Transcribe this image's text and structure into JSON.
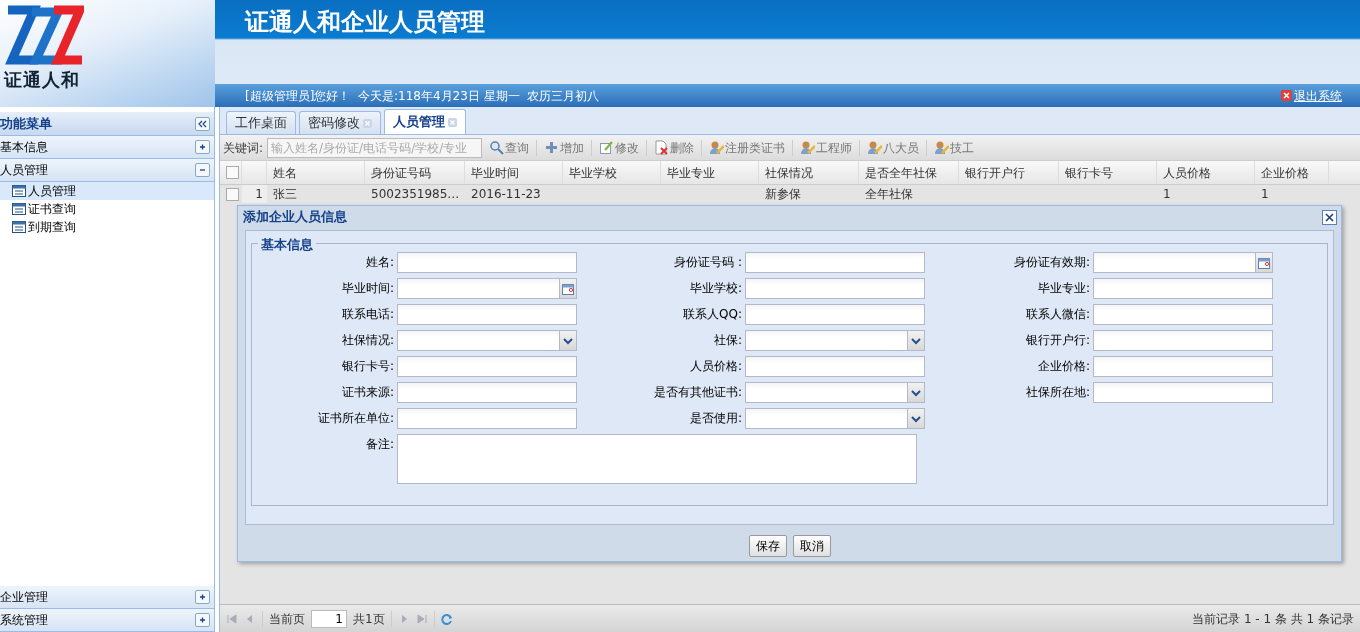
{
  "header": {
    "logo_text": "证通人和",
    "title": "证通人和企业人员管理",
    "greeting": "[超级管理员]您好！  今天是:118年4月23日 星期一  农历三月初八",
    "logout": "退出系统"
  },
  "sidebar": {
    "title": "功能菜单",
    "sections": [
      {
        "label": "基本信息",
        "expanded": false
      },
      {
        "label": "人员管理",
        "expanded": true,
        "children": [
          {
            "label": "人员管理",
            "selected": true
          },
          {
            "label": "证书查询",
            "selected": false
          },
          {
            "label": "到期查询",
            "selected": false
          }
        ]
      }
    ],
    "bottom_sections": [
      {
        "label": "企业管理",
        "expanded": false
      },
      {
        "label": "系统管理",
        "expanded": false
      }
    ]
  },
  "tabs": [
    {
      "label": "工作桌面",
      "selected": false,
      "closable": false
    },
    {
      "label": "密码修改",
      "selected": false,
      "closable": true
    },
    {
      "label": "人员管理",
      "selected": true,
      "closable": true
    }
  ],
  "toolbar": {
    "keyword_label": "关键词:",
    "search_placeholder": "输入姓名/身份证/电话号码/学校/专业",
    "buttons": [
      {
        "label": "查询",
        "kind": "search"
      },
      {
        "label": "增加",
        "kind": "add"
      },
      {
        "label": "修改",
        "kind": "edit"
      },
      {
        "label": "删除",
        "kind": "delete"
      },
      {
        "label": "注册类证书",
        "kind": "person"
      },
      {
        "label": "工程师",
        "kind": "person"
      },
      {
        "label": "八大员",
        "kind": "person"
      },
      {
        "label": "技工",
        "kind": "person"
      }
    ]
  },
  "table": {
    "all_checked": false,
    "columns": [
      "姓名",
      "身份证号码",
      "毕业时间",
      "毕业学校",
      "毕业专业",
      "社保情况",
      "是否全年社保",
      "银行开户行",
      "银行卡号",
      "人员价格",
      "企业价格"
    ],
    "rows": [
      {
        "number": "1",
        "checked": false,
        "cells": [
          "张三",
          "5002351985…",
          "2016-11-23",
          null,
          null,
          "新参保",
          "全年社保",
          null,
          null,
          "1",
          "1"
        ]
      }
    ]
  },
  "dialog": {
    "title": "添加企业人员信息",
    "legend": "基本信息",
    "fields": [
      {
        "label": "姓名:",
        "kind": "text"
      },
      {
        "label": "身份证号码 :",
        "kind": "text"
      },
      {
        "label": "身份证有效期:",
        "kind": "date"
      },
      {
        "label": "毕业时间:",
        "kind": "date"
      },
      {
        "label": "毕业学校:",
        "kind": "text"
      },
      {
        "label": "毕业专业:",
        "kind": "text"
      },
      {
        "label": "联系电话:",
        "kind": "text"
      },
      {
        "label": "联系人QQ:",
        "kind": "text"
      },
      {
        "label": "联系人微信:",
        "kind": "text"
      },
      {
        "label": "社保情况:",
        "kind": "select"
      },
      {
        "label": "社保:",
        "kind": "select"
      },
      {
        "label": "银行开户行:",
        "kind": "text"
      },
      {
        "label": "银行卡号:",
        "kind": "text"
      },
      {
        "label": "人员价格:",
        "kind": "text"
      },
      {
        "label": "企业价格:",
        "kind": "text"
      },
      {
        "label": "证书来源:",
        "kind": "text"
      },
      {
        "label": "是否有其他证书:",
        "kind": "select"
      },
      {
        "label": "社保所在地:",
        "kind": "text"
      },
      {
        "label": "证书所在单位:",
        "kind": "text"
      },
      {
        "label": "是否使用:",
        "kind": "select"
      },
      {
        "label": "备注:",
        "kind": "textarea"
      }
    ],
    "buttons": [
      "保存",
      "取消"
    ]
  },
  "pager": {
    "page_label": "当前页",
    "page_value": "1",
    "total_pages": "共1页",
    "summary": "当前记录 1 - 1 条 共 1 条记录"
  }
}
